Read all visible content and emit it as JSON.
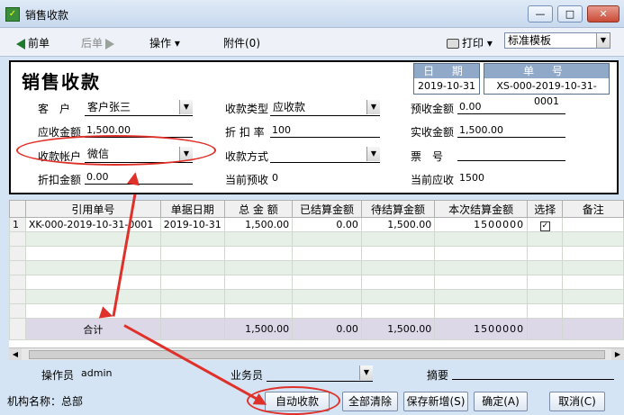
{
  "window": {
    "title": "销售收款",
    "min": "—",
    "max": "□",
    "close": "✕"
  },
  "toolbar": {
    "prev": "前单",
    "next": "后单",
    "operate": "操作",
    "attach": "附件(0)",
    "print": "打印",
    "template": "标准模板"
  },
  "form": {
    "title": "销售收款",
    "date_caption": "日 期",
    "date_value": "2019-10-31",
    "no_caption": "单 号",
    "no_value": "XS-000-2019-10-31-0001",
    "customer_label": "客　户",
    "customer_value": "客户张三",
    "receivable_label": "应收金额",
    "receivable_value": "1,500.00",
    "account_label": "收款帐户",
    "account_value": "微信",
    "discount_label": "折扣金额",
    "discount_value": "0.00",
    "type_label": "收款类型",
    "type_value": "应收款",
    "rate_label": "折 扣 率",
    "rate_value": "100",
    "method_label": "收款方式",
    "method_value": "",
    "cur_prepay_label": "当前预收",
    "cur_prepay_value": "0",
    "prepay_label": "预收金额",
    "prepay_value": "0.00",
    "actual_label": "实收金额",
    "actual_value": "1,500.00",
    "invoice_label": "票　号",
    "invoice_value": "",
    "cur_recv_label": "当前应收",
    "cur_recv_value": "1500"
  },
  "grid": {
    "headers": [
      "引用单号",
      "单据日期",
      "总 金 额",
      "已结算金额",
      "待结算金额",
      "本次结算金额",
      "选择",
      "备注"
    ],
    "rows": [
      {
        "rownum": "1",
        "ref": "XK-000-2019-10-31-0001",
        "date": "2019-10-31",
        "total": "1,500.00",
        "settled": "0.00",
        "pending": "1,500.00",
        "current": "1500000",
        "checked": "✓",
        "note": ""
      }
    ],
    "sum_label": "合计",
    "sum_total": "1,500.00",
    "sum_settled": "0.00",
    "sum_pending": "1,500.00",
    "sum_current": "1500000"
  },
  "footer": {
    "operator_label": "操作员",
    "operator_value": "admin",
    "salesman_label": "业务员",
    "salesman_value": "",
    "memo_label": "摘要",
    "memo_value": "",
    "org_label": "机构名称：总部",
    "auto_btn": "自动收款",
    "clear_btn": "全部清除",
    "save_new_btn": "保存新增(S)",
    "ok_btn": "确定(A)",
    "cancel_btn": "取消(C)"
  },
  "colors": {
    "annotation": "#e0302a",
    "header_caption": "#90a9c9",
    "alt_row": "#e6f0e6"
  }
}
